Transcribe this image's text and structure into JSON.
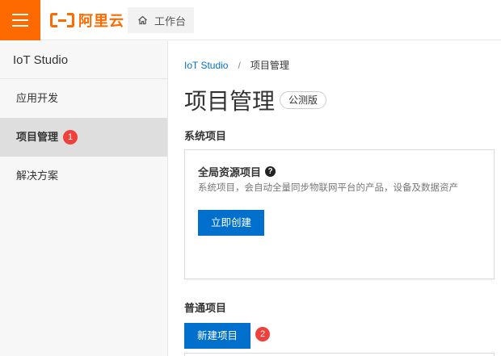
{
  "topbar": {
    "logo_text": "阿里云",
    "workbench_label": "工作台"
  },
  "sidebar": {
    "title": "IoT Studio",
    "items": [
      {
        "label": "应用开发"
      },
      {
        "label": "项目管理",
        "badge": "1"
      },
      {
        "label": "解决方案"
      }
    ]
  },
  "breadcrumb": {
    "root": "IoT Studio",
    "separator": "/",
    "current": "项目管理"
  },
  "page": {
    "title": "项目管理",
    "edition": "公测版"
  },
  "system_section": {
    "title": "系统项目",
    "card": {
      "title": "全局资源项目",
      "help": "?",
      "description": "系统项目，会自动全量同步物联网平台的产品，设备及数据资产",
      "button": "立即创建"
    }
  },
  "normal_section": {
    "title": "普通项目",
    "button": "新建项目",
    "badge": "2"
  },
  "colors": {
    "accent": "#ff6a00",
    "primary": "#0070cc",
    "badge": "#f0403c"
  }
}
